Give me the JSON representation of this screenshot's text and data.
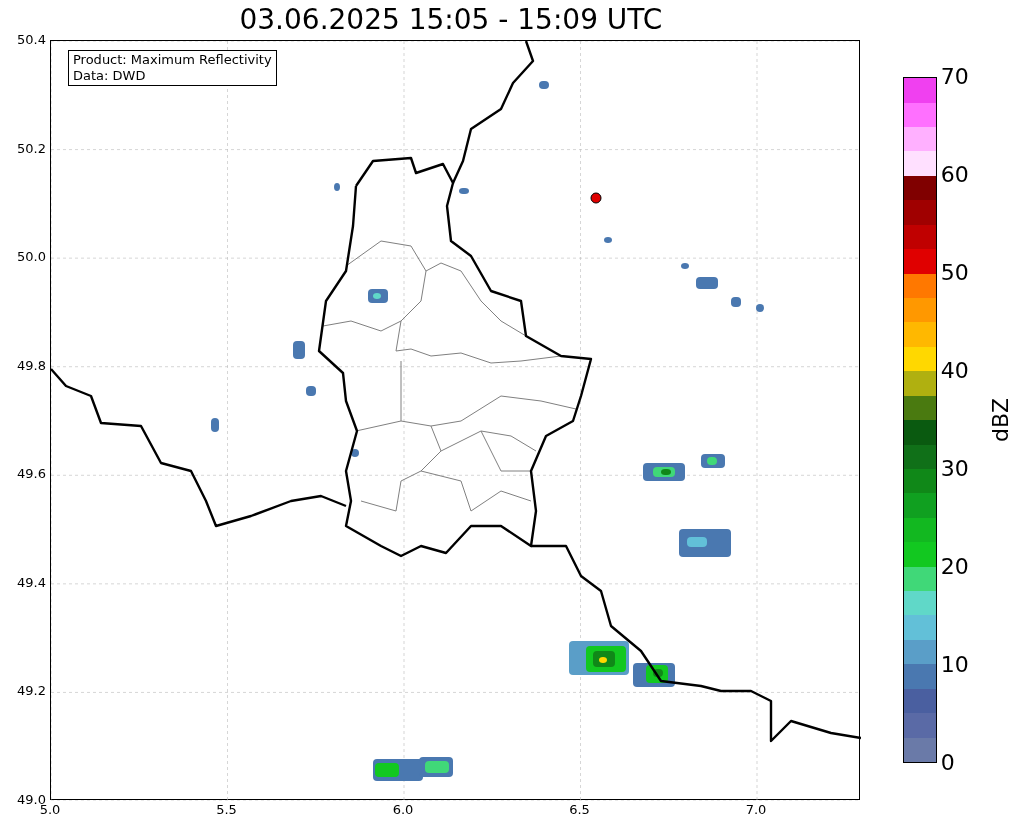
{
  "title": "03.06.2025 15:05 - 15:09 UTC",
  "info_box": [
    "Product: Maximum Reflectivity",
    "Data: DWD"
  ],
  "y_ticks": [
    "50.4",
    "50.2",
    "50.0",
    "49.8",
    "49.6",
    "49.4",
    "49.2",
    "49.0"
  ],
  "x_ticks": [
    "5.0",
    "5.5",
    "6.0",
    "6.5",
    "7.0"
  ],
  "colorbar": {
    "label": "dBZ",
    "ticks": [
      "70",
      "60",
      "50",
      "40",
      "30",
      "20",
      "10",
      "0"
    ],
    "bands": [
      {
        "color": "#6a7aa8"
      },
      {
        "color": "#5a6aa6"
      },
      {
        "color": "#4a5fa0"
      },
      {
        "color": "#4a78b0"
      },
      {
        "color": "#5a9ec8"
      },
      {
        "color": "#62c0d8"
      },
      {
        "color": "#60d8c8"
      },
      {
        "color": "#40d878"
      },
      {
        "color": "#12c820"
      },
      {
        "color": "#12b820"
      },
      {
        "color": "#10a020"
      },
      {
        "color": "#108818"
      },
      {
        "color": "#107018"
      },
      {
        "color": "#0a5a10"
      },
      {
        "color": "#4a7a10"
      },
      {
        "color": "#b0b010"
      },
      {
        "color": "#ffd800"
      },
      {
        "color": "#ffb800"
      },
      {
        "color": "#ff9800"
      },
      {
        "color": "#ff7800"
      },
      {
        "color": "#e00000"
      },
      {
        "color": "#c00000"
      },
      {
        "color": "#a00000"
      },
      {
        "color": "#800000"
      },
      {
        "color": "#ffe0ff"
      },
      {
        "color": "#ffb0ff"
      },
      {
        "color": "#ff70ff"
      },
      {
        "color": "#f040f0"
      }
    ]
  }
}
